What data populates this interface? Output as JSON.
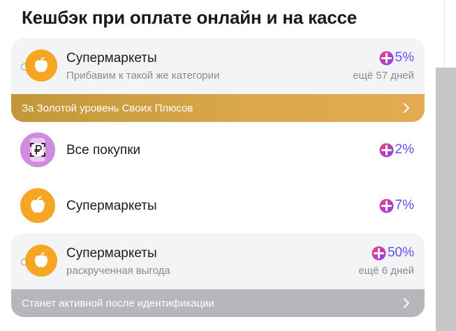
{
  "header": {
    "title": "Кешбэк при оплате онлайн и на кассе"
  },
  "colors": {
    "accent": "#6a4cf0",
    "gold_banner": "#d9a74a",
    "gray_banner": "#b6b6bb",
    "orange_icon": "#f5a623"
  },
  "items": [
    {
      "name": "Супермаркеты",
      "subtitle": "Прибавим к такой же категории",
      "percent": "5%",
      "days": "ещё 57 дней",
      "icon": "apple-icon",
      "banner": "За Золотой уровень Своих Плюсов"
    },
    {
      "name": "Все покупки",
      "percent": "2%",
      "icon": "ruble-scan-icon"
    },
    {
      "name": "Супермаркеты",
      "percent": "7%",
      "icon": "apple-icon"
    },
    {
      "name": "Супермаркеты",
      "subtitle": "раскрученная выгода",
      "percent": "50%",
      "days": "ещё 6 дней",
      "icon": "apple-icon",
      "banner": "Станет активной после идентификации"
    }
  ]
}
